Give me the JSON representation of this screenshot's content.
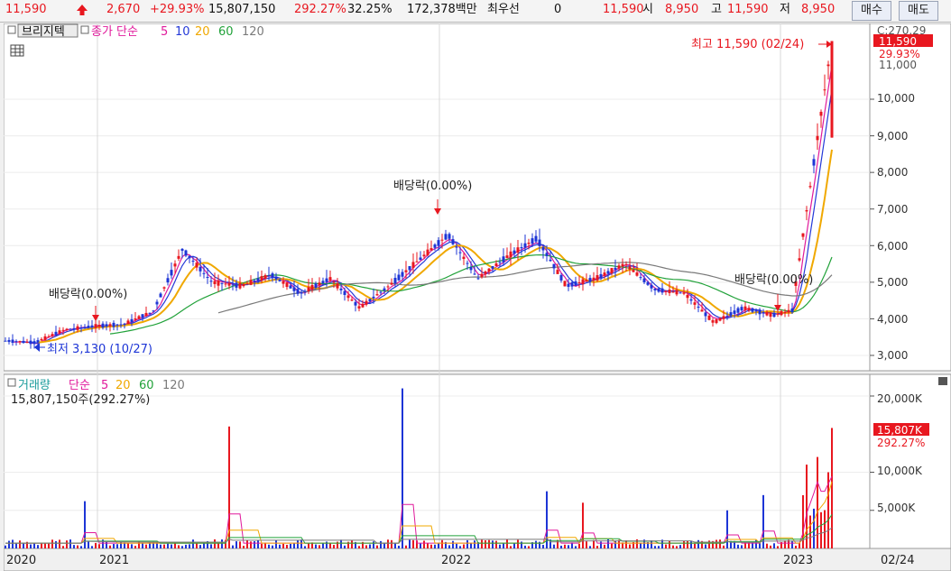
{
  "topbar": {
    "price": "11,590",
    "change": "2,670",
    "change_pct": "+29.93%",
    "volume": "15,807,150",
    "volume_ratio": "292.27%",
    "turnover": "32.25%",
    "amount": "172,378백만",
    "best_ask_label": "최우선",
    "best_ask_value": "0",
    "last_price": "11,590",
    "open_label": "시",
    "open_value": "8,950",
    "high_label": "고",
    "high_value": "11,590",
    "low_label": "저",
    "low_value": "8,950",
    "buy_button": "매수",
    "sell_button": "매도"
  },
  "price_panel": {
    "indicator_tab": "브리지텍",
    "ma_label": "종가 단순",
    "ma_periods": [
      "5",
      "10",
      "20",
      "60",
      "120"
    ],
    "high_annotation": "최고 11,590 (02/24)",
    "low_annotation": "최저 3,130 (10/27)",
    "dividend_label": "배당락(0.00%)",
    "axis_price_tag": "11,590",
    "axis_pct_tag": "29.93%",
    "axis_top_partial": "C:270.29",
    "axis_top_partial2": "11,000",
    "y_ticks": [
      "10,000",
      "9,000",
      "8,000",
      "7,000",
      "6,000",
      "5,000",
      "4,000",
      "3,000"
    ]
  },
  "volume_panel": {
    "title": "거래량",
    "ma_label": "단순",
    "ma_periods": [
      "5",
      "20",
      "60",
      "120"
    ],
    "current": "15,807,150주(292.27%)",
    "axis_tag": "15,807K",
    "axis_pct_tag": "292.27%",
    "y_ticks": [
      "20,000K",
      "10,000K",
      "5,000K"
    ]
  },
  "x_axis": {
    "labels": [
      "2020",
      "2021",
      "2022",
      "2023"
    ],
    "right_label": "02/24"
  },
  "colors": {
    "up": "#e8171f",
    "down": "#1d35d6",
    "ma5": "#e0199b",
    "ma10": "#2439d8",
    "ma20": "#f0a800",
    "ma60": "#22a23a",
    "ma120": "#7a7a7a",
    "volume_title": "#1a9b9b"
  },
  "chart_data": {
    "type": "candlestick",
    "title": "브리지텍",
    "x_range": [
      "2020-10",
      "2023-02-24"
    ],
    "y_range": [
      2800,
      11700
    ],
    "price_series": {
      "x": [
        "2020-10",
        "2020-11",
        "2020-12",
        "2021-01",
        "2021-02",
        "2021-03",
        "2021-04",
        "2021-05",
        "2021-06",
        "2021-07",
        "2021-08",
        "2021-09",
        "2021-10",
        "2021-11",
        "2021-12",
        "2022-01",
        "2022-02",
        "2022-03",
        "2022-04",
        "2022-05",
        "2022-06",
        "2022-07",
        "2022-08",
        "2022-09",
        "2022-10",
        "2022-11",
        "2022-12",
        "2023-01",
        "2023-02"
      ],
      "close": [
        3400,
        3350,
        3700,
        3800,
        3850,
        4200,
        5900,
        5000,
        4900,
        5200,
        4700,
        5100,
        4300,
        4900,
        5600,
        6300,
        5100,
        5700,
        6200,
        4900,
        5100,
        5500,
        4800,
        4700,
        3900,
        4300,
        4100,
        4300,
        11590
      ]
    },
    "events": [
      {
        "label": "최저",
        "value": 3130,
        "date": "10/27"
      },
      {
        "label": "최고",
        "value": 11590,
        "date": "02/24"
      },
      {
        "label": "배당락",
        "pct": "0.00%"
      }
    ],
    "volume_ticks": [
      "5,000K",
      "10,000K",
      "20,000K"
    ],
    "volume_last": 15807150
  }
}
